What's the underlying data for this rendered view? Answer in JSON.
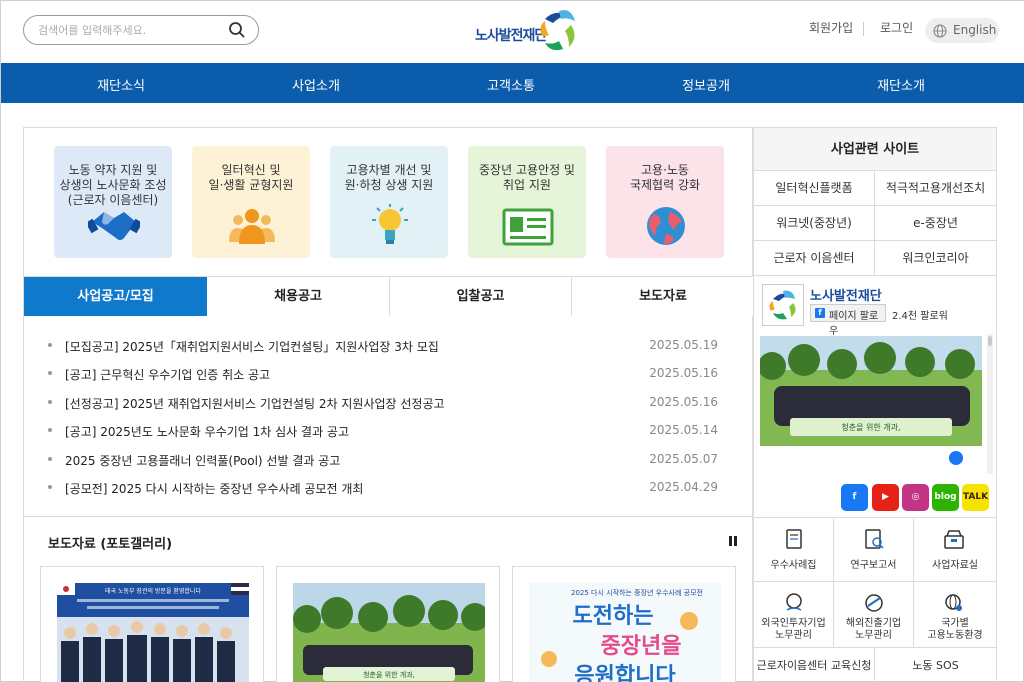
{
  "header": {
    "search_placeholder": "검색어를 입력해주세요.",
    "logo_text": "노사발전재단",
    "signup": "회원가입",
    "login": "로그인",
    "language": "English"
  },
  "nav": [
    "재단소식",
    "사업소개",
    "고객소통",
    "정보공개",
    "재단소개"
  ],
  "cards": [
    {
      "label": "노동 약자 지원 및\n상생의 노사문화 조성\n(근로자 이음센터)",
      "icon": "handshake-icon",
      "bg": "#dde9f7"
    },
    {
      "label": "일터혁신 및\n일·생활 균형지원",
      "icon": "people-icon",
      "bg": "#fdf2d5"
    },
    {
      "label": "고용차별 개선 및\n원·하청 상생 지원",
      "icon": "lightbulb-icon",
      "bg": "#e2f1f5"
    },
    {
      "label": "중장년 고용안정 및\n취업 지원",
      "icon": "id-card-icon",
      "bg": "#e6f4d9"
    },
    {
      "label": "고용·노동\n국제협력 강화",
      "icon": "globe-icon",
      "bg": "#fbe3e9"
    }
  ],
  "tabs": [
    "사업공고/모집",
    "채용공고",
    "입찰공고",
    "보도자료"
  ],
  "notices": [
    {
      "title": "[모집공고] 2025년「재취업지원서비스 기업컨설팅」지원사업장 3차 모집",
      "date": "2025.05.19"
    },
    {
      "title": "[공고] 근무혁신 우수기업 인증 취소 공고",
      "date": "2025.05.16"
    },
    {
      "title": "[선정공고] 2025년 재취업지원서비스 기업컨설팅 2차 지원사업장 선정공고",
      "date": "2025.05.16"
    },
    {
      "title": "[공고] 2025년도 노사문화 우수기업 1차 심사 결과 공고",
      "date": "2025.05.14"
    },
    {
      "title": "2025 중장년 고용플래너 인력풀(Pool) 선발 결과 공고",
      "date": "2025.05.07"
    },
    {
      "title": "[공모전] 2025 다시 시작하는 중장년 우수사례 공모전 개최",
      "date": "2025.04.29"
    }
  ],
  "press": {
    "title": "보도자료 (포토갤러리)",
    "photo1_banner": "태국 노동부 장관의 방문을 환영합니다",
    "photo3_top": "2025 다시 시작하는 중장년 우수사례 공모전",
    "photo3_line1": "도전하는",
    "photo3_line2": "중장년을",
    "photo3_line3": "응원합니다"
  },
  "side": {
    "title": "사업관련 사이트",
    "links": [
      "일터혁신플랫폼",
      "적극적고용개선조치",
      "워크넷(중장년)",
      "e-중장년",
      "근로자 이음센터",
      "워크인코리아"
    ]
  },
  "facebook": {
    "name": "노사발전재단",
    "follow": "페이지 팔로우",
    "followers": "2.4천 팔로워",
    "banner": "청춘을 위한 개과,"
  },
  "social": [
    {
      "name": "facebook-icon",
      "label": "f",
      "color": "#1877f2"
    },
    {
      "name": "youtube-icon",
      "label": "▶",
      "color": "#e62117"
    },
    {
      "name": "instagram-icon",
      "label": "◎",
      "color": "#c13584"
    },
    {
      "name": "blog-icon",
      "label": "blog",
      "color": "#2db400"
    },
    {
      "name": "kakaotalk-icon",
      "label": "TALK",
      "color": "#f7e300"
    }
  ],
  "sub_menu": [
    {
      "label": "우수사례집",
      "icon": "book-icon"
    },
    {
      "label": "연구보고서",
      "icon": "report-icon"
    },
    {
      "label": "사업자료실",
      "icon": "archive-icon"
    },
    {
      "label": "외국인투자기업\n노무관리",
      "icon": "foreign-invest-icon"
    },
    {
      "label": "해외진출기업\n노무관리",
      "icon": "overseas-icon"
    },
    {
      "label": "국가별\n고용노동환경",
      "icon": "country-globe-icon"
    }
  ],
  "bottom_links": [
    "근로자이음센터 교육신청",
    "노동 SOS"
  ]
}
